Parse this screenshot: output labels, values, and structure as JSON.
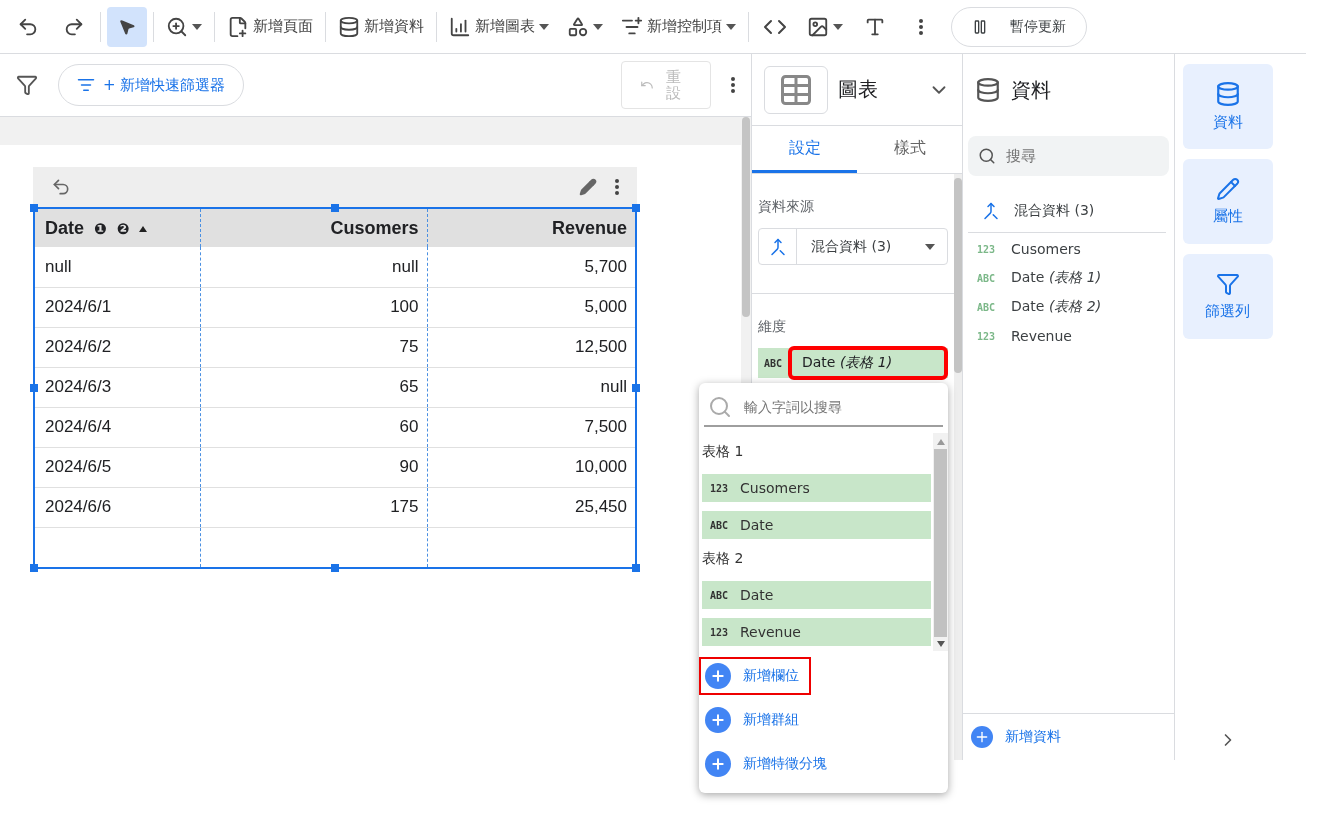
{
  "toolbar": {
    "tools": [
      {
        "kind": "undo",
        "selected": false
      },
      {
        "kind": "redo",
        "selected": false
      },
      {
        "kind": "pointer",
        "selected": true
      },
      {
        "kind": "zoom",
        "selected": false
      }
    ],
    "buttons": [
      {
        "kind": "page",
        "label": "新增頁面",
        "caret": false
      },
      {
        "kind": "data",
        "label": "新增資料",
        "caret": false
      },
      {
        "kind": "chart",
        "label": "新增圖表",
        "caret": true
      },
      {
        "kind": "controls",
        "label": "新增控制項",
        "caret": true
      }
    ],
    "pause_button": "暫停更新"
  },
  "filter_bar": {
    "add_filter": "+ 新增快速篩選器",
    "reset": "重設",
    "reset_disabled": true
  },
  "table": {
    "columns": [
      {
        "label": "Date",
        "badges": [
          "❶",
          "❷"
        ],
        "sorted": true
      },
      {
        "label": "Cusomers",
        "sorted": false
      },
      {
        "label": "Revenue",
        "sorted": false
      }
    ],
    "rows": [
      [
        "null",
        "null",
        "5,700"
      ],
      [
        "2024/6/1",
        "100",
        "5,000"
      ],
      [
        "2024/6/2",
        "75",
        "12,500"
      ],
      [
        "2024/6/3",
        "65",
        "null"
      ],
      [
        "2024/6/4",
        "60",
        "7,500"
      ],
      [
        "2024/6/5",
        "90",
        "10,000"
      ],
      [
        "2024/6/6",
        "175",
        "25,450"
      ]
    ],
    "selected": true
  },
  "chart_panel": {
    "title": "圖表",
    "tabs": [
      {
        "label": "設定",
        "selected": true
      },
      {
        "label": "樣式",
        "selected": false
      }
    ],
    "data_source_label": "資料來源",
    "data_source": "混合資料 (3)",
    "dimension_label": "維度",
    "dimension": {
      "type": "ABC",
      "name": "Date *(表格 1)*",
      "highlighted": true
    }
  },
  "data_panel": {
    "title": "資料",
    "search_placeholder": "搜尋",
    "source": "混合資料 (3)",
    "fields": [
      {
        "type": "123",
        "name": "Cusomers"
      },
      {
        "type": "ABC",
        "name": "Date *(表格 1)*"
      },
      {
        "type": "ABC",
        "name": "Date *(表格 2)*"
      },
      {
        "type": "123",
        "name": "Revenue"
      }
    ],
    "add_data": "新增資料"
  },
  "rail": [
    {
      "kind": "data",
      "label": "資料"
    },
    {
      "kind": "edit",
      "label": "屬性"
    },
    {
      "kind": "filter",
      "label": "篩選列"
    }
  ],
  "popup": {
    "search_placeholder": "輸入字詞以搜尋",
    "groups": [
      {
        "title": "表格 1",
        "fields": [
          {
            "type": "123",
            "name": "Cusomers"
          },
          {
            "type": "ABC",
            "name": "Date"
          }
        ]
      },
      {
        "title": "表格 2",
        "fields": [
          {
            "type": "ABC",
            "name": "Date"
          },
          {
            "type": "123",
            "name": "Revenue"
          }
        ]
      }
    ],
    "actions": [
      {
        "label": "新增欄位",
        "highlighted": true
      },
      {
        "label": "新增群組",
        "highlighted": false
      },
      {
        "label": "新增特徵分塊",
        "highlighted": false
      }
    ]
  }
}
